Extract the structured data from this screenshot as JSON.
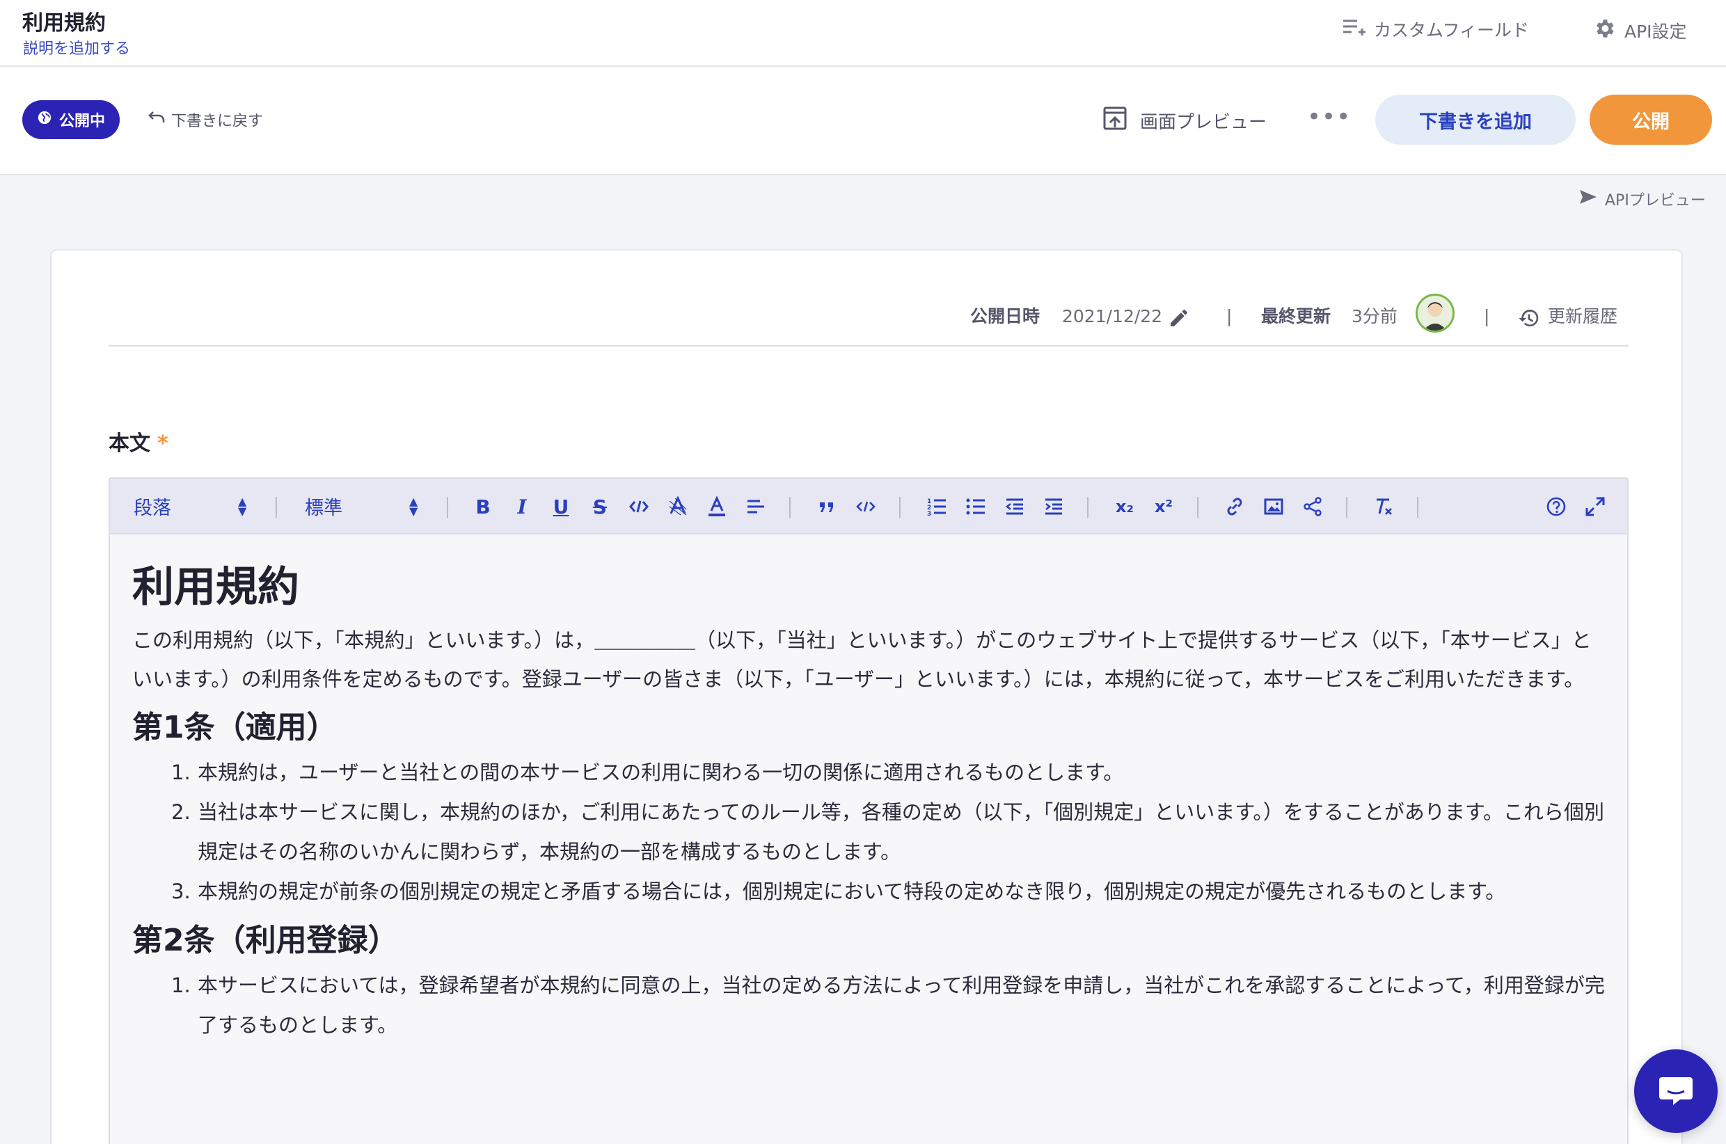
{
  "header": {
    "title": "利用規約",
    "add_description": "説明を追加する",
    "custom_field": "カスタムフィールド",
    "api_settings": "API設定"
  },
  "actions": {
    "status": "公開中",
    "back_to_draft": "下書きに戻す",
    "screen_preview": "画面プレビュー",
    "more": "•••",
    "add_draft": "下書きを追加",
    "publish": "公開",
    "api_preview": "APIプレビュー"
  },
  "meta": {
    "published_label": "公開日時",
    "published_value": "2021/12/22",
    "sep1": "|",
    "updated_label": "最終更新",
    "updated_value": "3分前",
    "sep2": "|",
    "history": "更新履歴"
  },
  "field": {
    "label": "本文",
    "required_mark": "*"
  },
  "toolbar": {
    "block_format": "段落",
    "font_size": "標準",
    "bold": "B",
    "italic": "I",
    "underline": "U",
    "strike": "S",
    "subscript": "x₂",
    "superscript": "x²"
  },
  "document": {
    "title": "利用規約",
    "intro": "この利用規約（以下，「本規約」といいます。）は，＿＿＿＿＿（以下，「当社」といいます。）がこのウェブサイト上で提供するサービス（以下，「本サービス」といいます。）の利用条件を定めるものです。登録ユーザーの皆さま（以下，「ユーザー」といいます。）には，本規約に従って，本サービスをご利用いただきます。",
    "article1_title": "第1条（適用）",
    "article1_items": [
      {
        "num": "1.",
        "text": "本規約は，ユーザーと当社との間の本サービスの利用に関わる一切の関係に適用されるものとします。"
      },
      {
        "num": "2.",
        "text": "当社は本サービスに関し，本規約のほか，ご利用にあたってのルール等，各種の定め（以下，「個別規定」といいます。）をすることがあります。これら個別規定はその名称のいかんに関わらず，本規約の一部を構成するものとします。"
      },
      {
        "num": "3.",
        "text": "本規約の規定が前条の個別規定の規定と矛盾する場合には，個別規定において特段の定めなき限り，個別規定の規定が優先されるものとします。"
      }
    ],
    "article2_title": "第2条（利用登録）",
    "article2_items": [
      {
        "num": "1.",
        "text": "本サービスにおいては，登録希望者が本規約に同意の上，当社の定める方法によって利用登録を申請し，当社がこれを承認することによって，利用登録が完了するものとします。"
      }
    ]
  },
  "colors": {
    "primary": "#2a23b3",
    "accent_orange": "#f2963b",
    "link_blue": "#3a49c7"
  },
  "icons": [
    "custom-field-icon",
    "gear-icon",
    "globe-icon",
    "undo-icon",
    "preview-icon",
    "send-icon",
    "pencil-icon",
    "history-icon",
    "chat-icon"
  ]
}
